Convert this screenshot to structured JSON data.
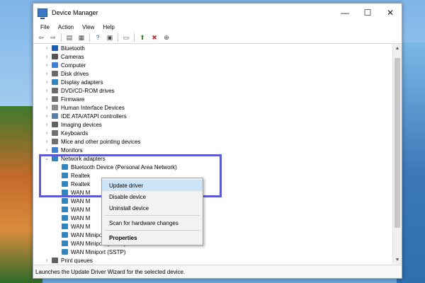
{
  "window": {
    "title": "Device Manager",
    "controls": {
      "minimize": "—",
      "maximize": "☐",
      "close": "✕"
    }
  },
  "menu": [
    "File",
    "Action",
    "View",
    "Help"
  ],
  "tree": {
    "categories": [
      {
        "label": "Bluetooth",
        "expander": "›",
        "icon_color": "#1a5fb4"
      },
      {
        "label": "Cameras",
        "expander": "›",
        "icon_color": "#555555"
      },
      {
        "label": "Computer",
        "expander": "›",
        "icon_color": "#3b82d6"
      },
      {
        "label": "Disk drives",
        "expander": "›",
        "icon_color": "#6b6b6b"
      },
      {
        "label": "Display adapters",
        "expander": "›",
        "icon_color": "#2e86c1"
      },
      {
        "label": "DVD/CD-ROM drives",
        "expander": "›",
        "icon_color": "#6b6b6b"
      },
      {
        "label": "Firmware",
        "expander": "›",
        "icon_color": "#707070"
      },
      {
        "label": "Human Interface Devices",
        "expander": "›",
        "icon_color": "#8a8a8a"
      },
      {
        "label": "IDE ATA/ATAPI controllers",
        "expander": "›",
        "icon_color": "#5a7fa8"
      },
      {
        "label": "Imaging devices",
        "expander": "›",
        "icon_color": "#606060"
      },
      {
        "label": "Keyboards",
        "expander": "›",
        "icon_color": "#707070"
      },
      {
        "label": "Mice and other pointing devices",
        "expander": "›",
        "icon_color": "#707070"
      },
      {
        "label": "Monitors",
        "expander": "›",
        "icon_color": "#3b82d6"
      }
    ],
    "network": {
      "label": "Network adapters",
      "expander": "⌄",
      "icon_color": "#2e86c1",
      "children": [
        "Bluetooth Device (Personal Area Network)",
        "Realtek",
        "Realtek",
        "WAN M",
        "WAN M",
        "WAN M",
        "WAN M",
        "WAN M",
        "WAN Miniport (PPPOE)",
        "WAN Miniport (PPTP)",
        "WAN Miniport (SSTP)"
      ]
    },
    "after": {
      "label": "Print queues",
      "expander": "›",
      "icon_color": "#606060"
    }
  },
  "context_menu": {
    "items": [
      "Update driver",
      "Disable device",
      "Uninstall device"
    ],
    "scan": "Scan for hardware changes",
    "properties": "Properties",
    "active_color": "#cce4f7"
  },
  "status": "Launches the Update Driver Wizard for the selected device.",
  "colors": {
    "highlight": "#5b5bd6",
    "child_icon": "#2e86c1"
  }
}
